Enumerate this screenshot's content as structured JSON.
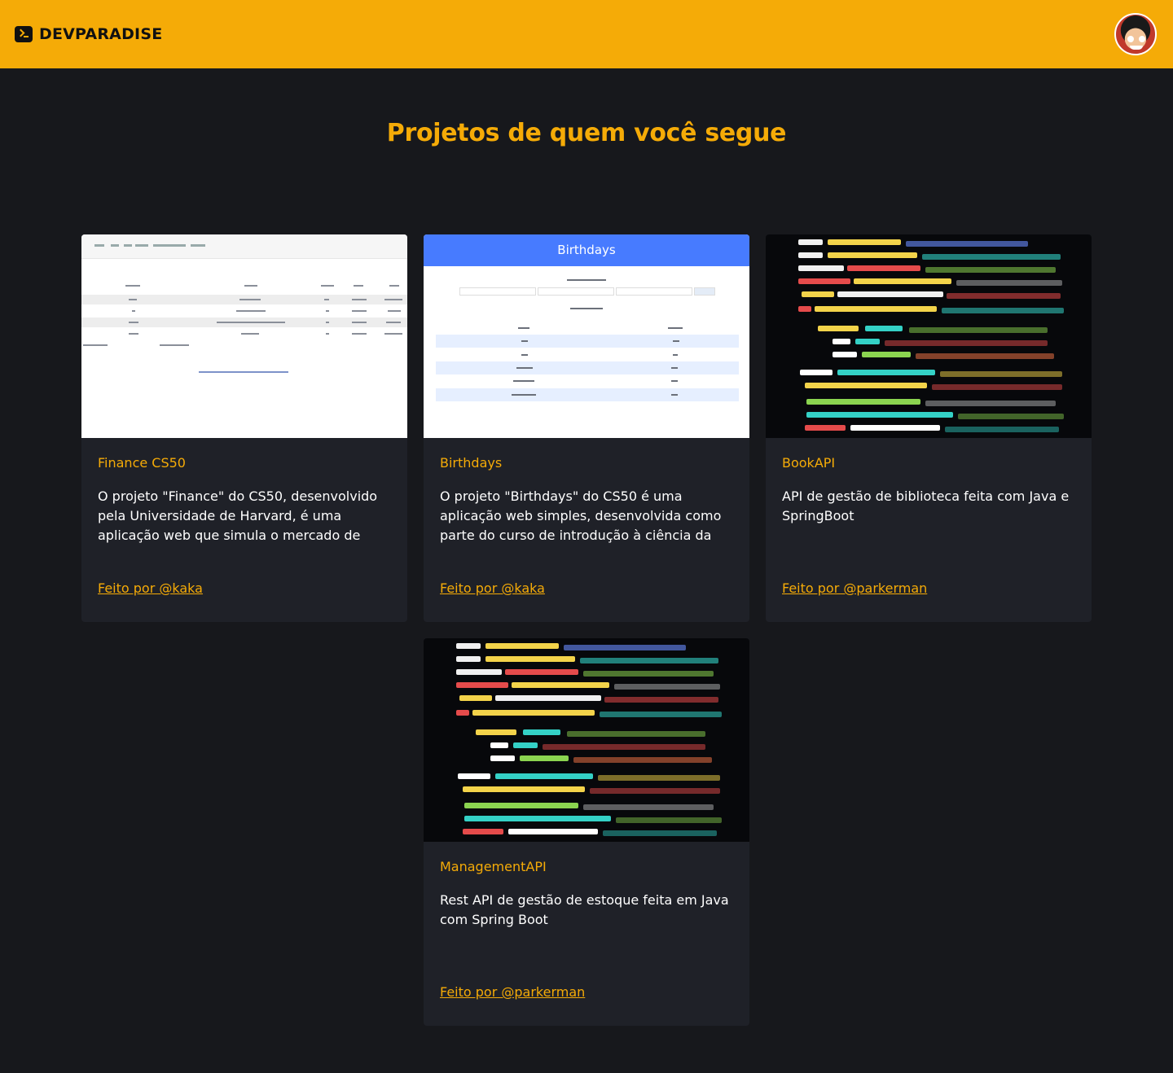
{
  "header": {
    "brand": "DEVPARADISE",
    "brand_icon": "terminal-icon",
    "avatar": "user-avatar"
  },
  "page": {
    "title": "Projetos de quem você segue"
  },
  "colors": {
    "accent": "#f5ab07",
    "background": "#17181c",
    "card": "#1f2128",
    "birthdays_header": "#477bff"
  },
  "projects": [
    {
      "title": "Finance CS50",
      "description": "O projeto \"Finance\" do CS50, desenvolvido pela Universidade de Harvard, é uma aplicação web que simula o mercado de",
      "author": "Feito por @kaka"
    },
    {
      "title": "Birthdays",
      "description": "O projeto \"Birthdays\" do CS50 é uma aplicação web simples, desenvolvida como parte do curso de introdução à ciência da",
      "author": "Feito por @kaka",
      "thumb_header": "Birthdays"
    },
    {
      "title": "BookAPI",
      "description": "API de gestão de biblioteca feita com Java e SpringBoot",
      "author": "Feito por @parkerman"
    },
    {
      "title": "ManagementAPI",
      "description": "Rest API de gestão de estoque feita em Java com Spring Boot",
      "author": "Feito por @parkerman"
    }
  ]
}
